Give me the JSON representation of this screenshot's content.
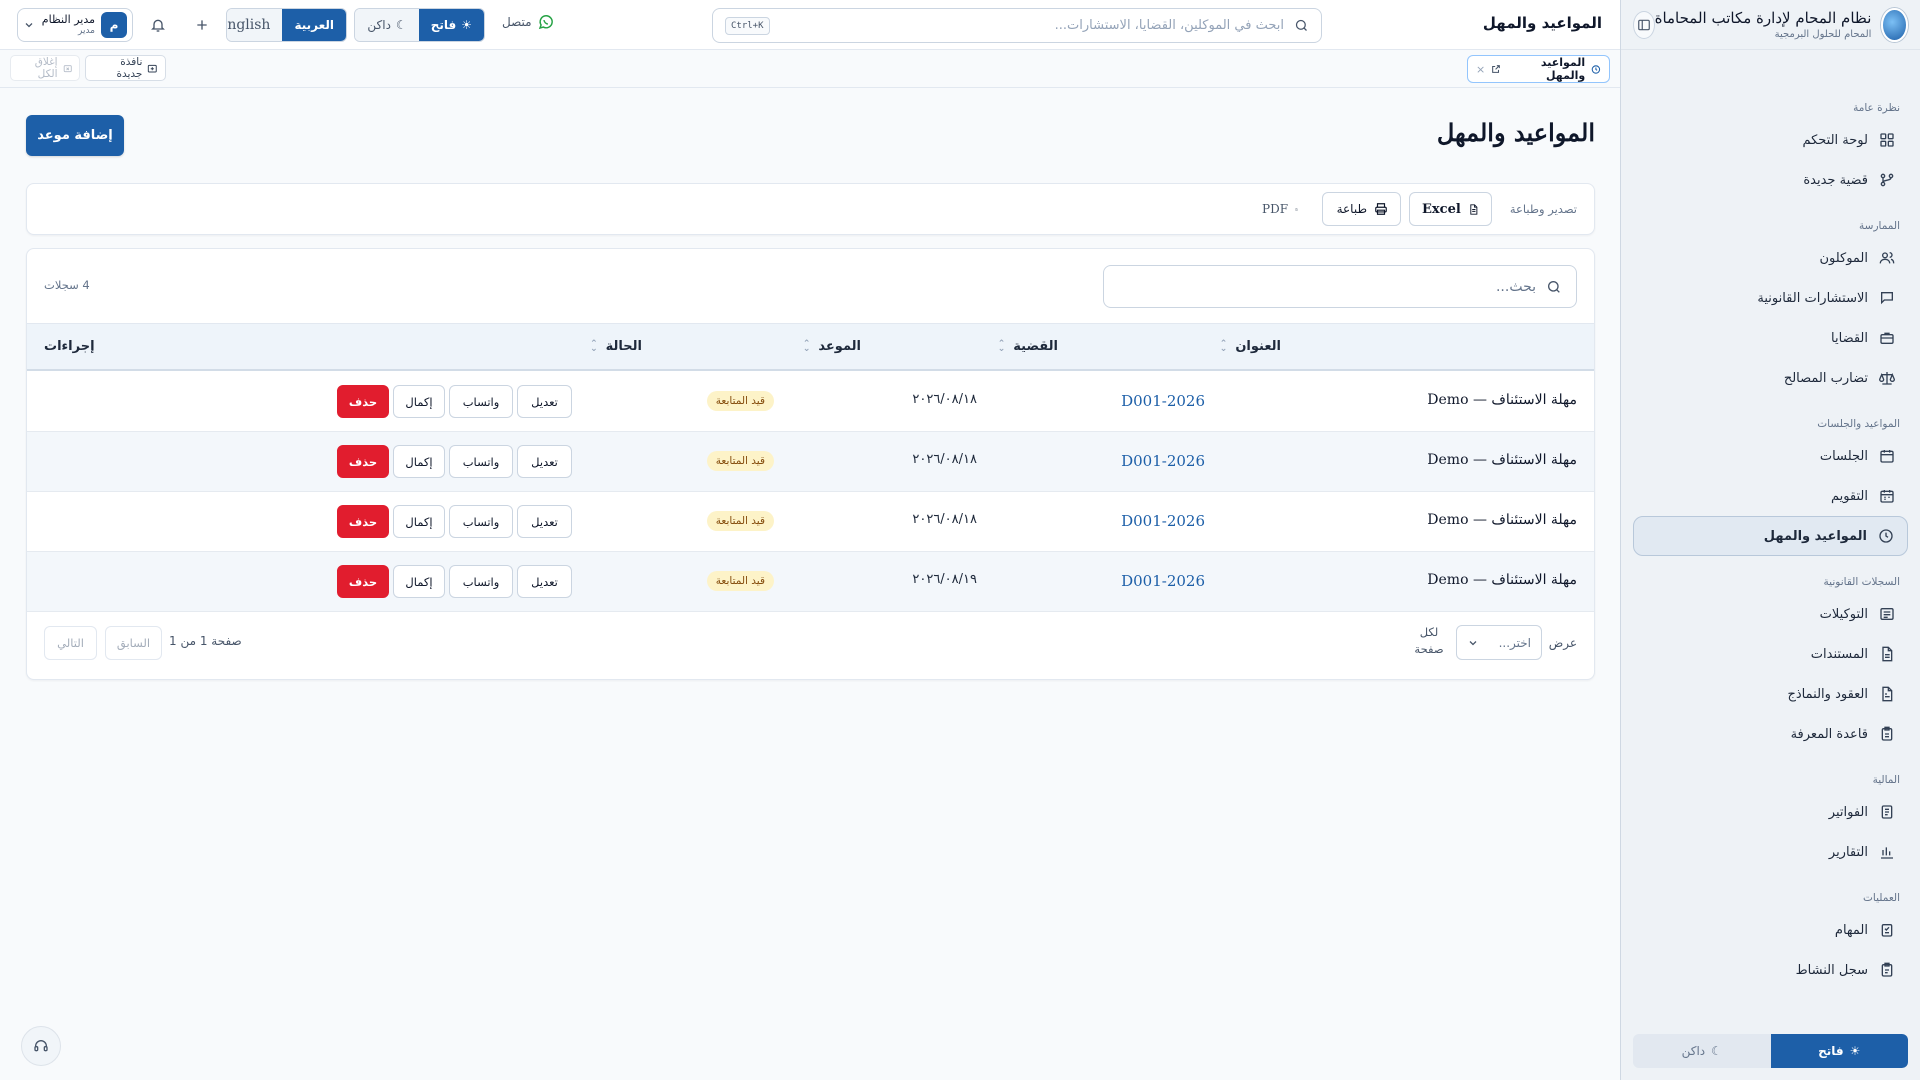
{
  "sidebar": {
    "brand_title": "نظام المحام لإدارة مكاتب المحاماة",
    "brand_subtitle": "المحام للحلول البرمجية",
    "sections": {
      "overview": "نظرة عامة",
      "practice": "الممارسة",
      "schedule": "المواعيد والجلسات",
      "records": "السجلات القانونية",
      "finance": "المالية",
      "operations": "العمليات"
    },
    "items": {
      "dashboard": "لوحة التحكم",
      "new_case": "قضية جديدة",
      "clients": "الموكلون",
      "consultations": "الاستشارات القانونية",
      "cases": "القضايا",
      "conflicts": "تضارب المصالح",
      "sessions": "الجلسات",
      "calendar": "التقويم",
      "deadlines": "المواعيد والمهل",
      "powers": "التوكيلات",
      "documents": "المستندات",
      "contracts": "العقود والنماذج",
      "knowledge": "قاعدة المعرفة",
      "invoices": "الفواتير",
      "reports": "التقارير",
      "tasks": "المهام",
      "activity": "سجل النشاط"
    },
    "theme_light": "فاتح",
    "theme_dark": "داكن"
  },
  "header": {
    "title": "المواعيد والمهل",
    "search_placeholder": "ابحث في الموكلين، القضايا، الاستشارات...",
    "shortcut": "Ctrl+K",
    "whatsapp_status": "متصل",
    "theme_light": "فاتح",
    "theme_dark": "داكن",
    "lang_ar": "العربية",
    "lang_en": "English",
    "user_name": "مدير النظام",
    "user_role": "مدير",
    "user_initial": "م"
  },
  "tabs": {
    "active_tab": "المواعيد والمهل",
    "new_window": "نافذة جديدة",
    "close_all": "إغلاق الكل"
  },
  "page": {
    "title": "المواعيد والمهل",
    "add_button": "إضافة موعد",
    "export_label": "تصدير وطباعة",
    "excel": "Excel",
    "print": "طباعة",
    "pdf": "PDF",
    "search_placeholder": "بحث...",
    "record_count": "4 سجلات"
  },
  "table": {
    "columns": {
      "title": "العنوان",
      "case": "القضية",
      "date": "الموعد",
      "status": "الحالة",
      "actions": "إجراءات"
    },
    "action_labels": {
      "edit": "تعديل",
      "whatsapp": "واتساب",
      "complete": "إكمال",
      "delete": "حذف"
    },
    "rows": [
      {
        "title": "مهلة الاستئناف — Demo",
        "case": "D001-2026",
        "date": "٢٠٢٦/٠٨/١٨",
        "status": "قيد المتابعة"
      },
      {
        "title": "مهلة الاستئناف — Demo",
        "case": "D001-2026",
        "date": "٢٠٢٦/٠٨/١٨",
        "status": "قيد المتابعة"
      },
      {
        "title": "مهلة الاستئناف — Demo",
        "case": "D001-2026",
        "date": "٢٠٢٦/٠٨/١٨",
        "status": "قيد المتابعة"
      },
      {
        "title": "مهلة الاستئناف — Demo",
        "case": "D001-2026",
        "date": "٢٠٢٦/٠٨/١٩",
        "status": "قيد المتابعة"
      }
    ]
  },
  "pagination": {
    "show_label": "عرض",
    "select_placeholder": "اختر...",
    "per_page": "لكل صفحة",
    "page_info": "صفحة 1 من 1",
    "prev": "السابق",
    "next": "التالي"
  },
  "colors": {
    "primary": "#1d5fa8",
    "danger": "#e11d2e",
    "badge_bg": "#fdf3c8",
    "whatsapp": "#25a244"
  }
}
